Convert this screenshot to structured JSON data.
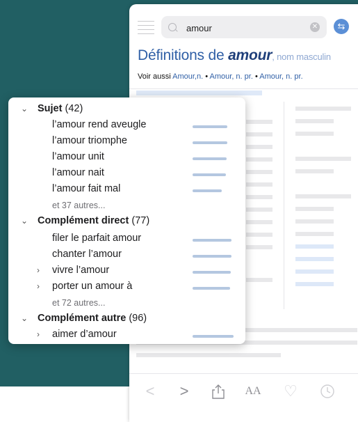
{
  "search": {
    "value": "amour",
    "clear_glyph": "✕",
    "back_glyph": "⇆"
  },
  "header": {
    "title_prefix": "Définitions de ",
    "title_word": "amour",
    "title_pos": ", nom masculin"
  },
  "see_also": {
    "label": "Voir aussi ",
    "links": [
      "Amour,n.",
      "Amour, n. pr.",
      "Amour, n. pr."
    ],
    "sep": " • "
  },
  "toolbar": {
    "back": "<",
    "forward": ">",
    "share": "share-icon",
    "font": "AA",
    "favorite": "♡",
    "history": "clock-icon"
  },
  "popup": {
    "groups": [
      {
        "name": "Sujet",
        "count": "(42)",
        "expanded": true,
        "items": [
          {
            "label": "l’amour rend aveugle",
            "level": 0.45
          },
          {
            "label": "l’amour triomphe",
            "level": 0.45
          },
          {
            "label": "l’amour unit",
            "level": 0.45
          },
          {
            "label": "l’amour nait",
            "level": 0.44
          },
          {
            "label": "l’amour fait mal",
            "level": 0.38
          }
        ],
        "more": "et 37 autres..."
      },
      {
        "name": "Complément direct",
        "count": "(77)",
        "expanded": true,
        "items": [
          {
            "label": "filer le parfait amour",
            "level": 0.52
          },
          {
            "label": "chanter l’amour",
            "level": 0.52
          },
          {
            "label": "vivre l’amour",
            "level": 0.51,
            "has_children": true
          },
          {
            "label": "porter un amour à",
            "level": 0.5,
            "has_children": true
          }
        ],
        "more": "et 72 autres..."
      },
      {
        "name": "Complément autre",
        "count": "(96)",
        "expanded": true,
        "items": [
          {
            "label": "aimer d’amour",
            "level": 0.55,
            "has_children": true
          }
        ]
      }
    ]
  }
}
